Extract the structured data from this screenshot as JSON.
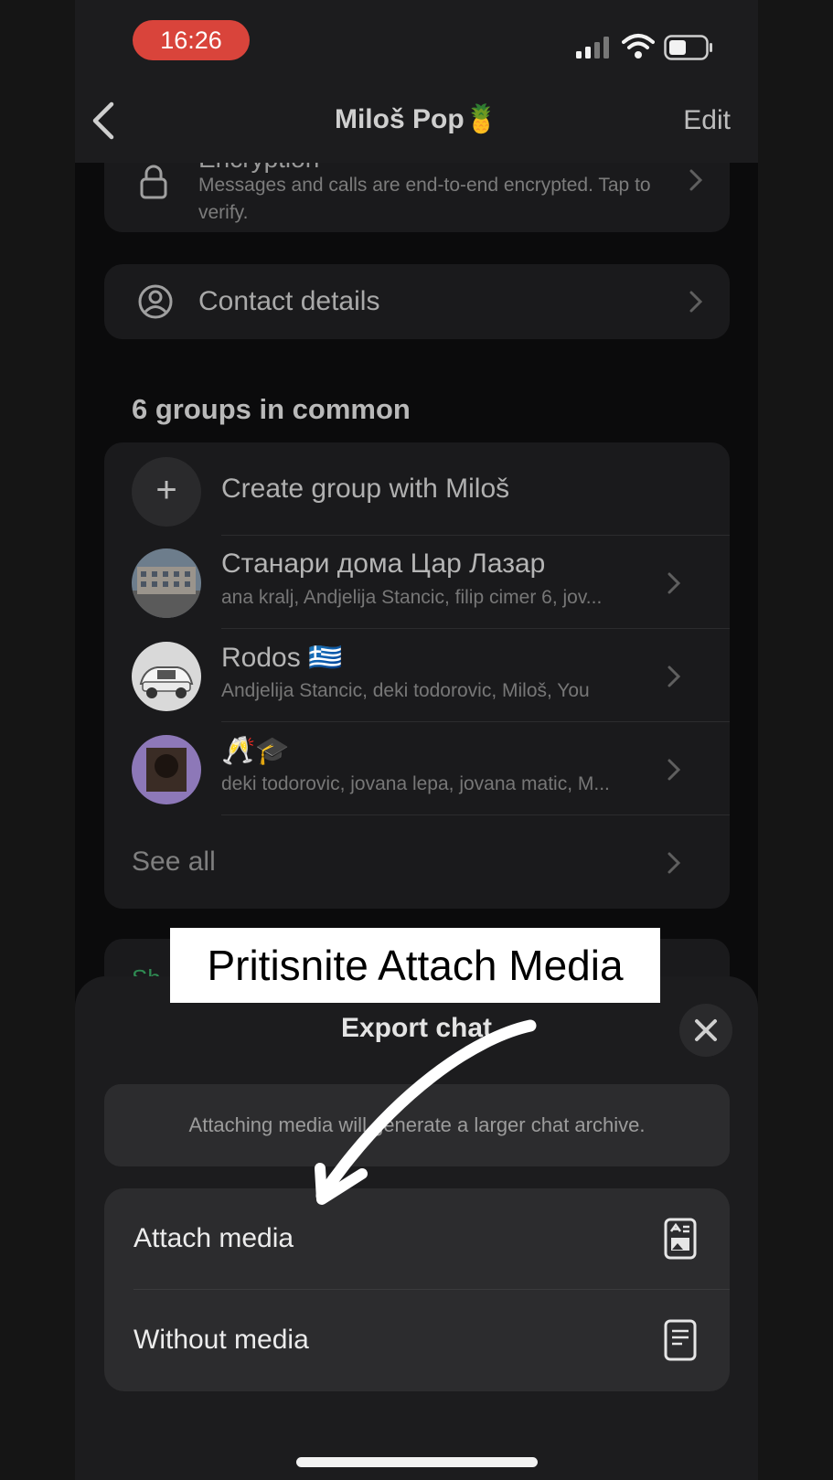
{
  "status_bar": {
    "time": "16:26"
  },
  "nav": {
    "title": "Miloš Pop🍍",
    "edit_label": "Edit"
  },
  "encryption": {
    "title": "Encryption",
    "subtitle": "Messages and calls are end-to-end encrypted. Tap to verify."
  },
  "contact_details": {
    "label": "Contact details"
  },
  "groups": {
    "section_title": "6 groups in common",
    "create_label": "Create group with Miloš",
    "items": [
      {
        "title": "Станари дома Цар Лазар",
        "members": "ana kralj, Andjelija Stancic, filip cimer 6, jov..."
      },
      {
        "title": "Rodos 🇬🇷",
        "members": "Andjelija Stancic, deki todorovic, Miloš, You"
      },
      {
        "title": "🥂🎓",
        "members": "deki todorovic, jovana lepa, jovana matic, M..."
      }
    ],
    "see_all": "See all"
  },
  "partial_section": {
    "text": "Sh"
  },
  "sheet": {
    "title": "Export chat",
    "info": "Attaching media will generate a larger chat archive.",
    "options": [
      {
        "label": "Attach media",
        "icon": "document-media-icon"
      },
      {
        "label": "Without media",
        "icon": "document-text-icon"
      }
    ]
  },
  "overlay": {
    "caption": "Pritisnite Attach Media"
  },
  "colors": {
    "status_time_bg": "#d9443b",
    "sheet_bg": "#1c1c1e",
    "option_bg": "#2c2c2e",
    "accent_green": "#2f8a52"
  }
}
